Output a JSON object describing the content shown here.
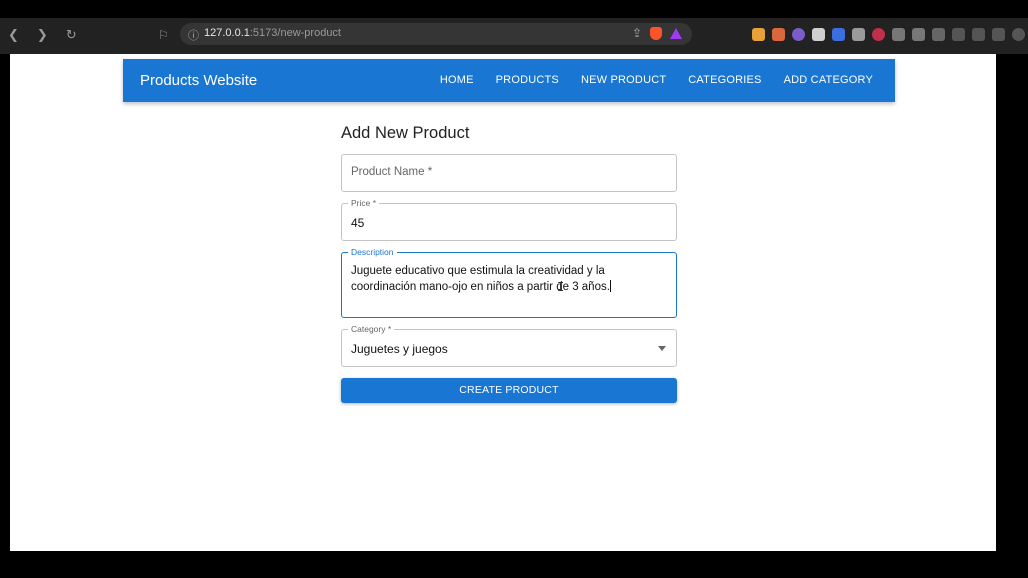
{
  "browser": {
    "url_host": "127.0.0.1",
    "url_path": ":5173/new-product"
  },
  "header": {
    "brand": "Products Website",
    "nav": [
      "HOME",
      "PRODUCTS",
      "NEW PRODUCT",
      "CATEGORIES",
      "ADD CATEGORY"
    ]
  },
  "form": {
    "title": "Add New Product",
    "product_name": {
      "placeholder": "Product Name *",
      "value": ""
    },
    "price": {
      "label": "Price *",
      "value": "45"
    },
    "description": {
      "label": "Description",
      "value": "Juguete educativo que estimula la creatividad y la coordinación mano-ojo en niños a partir de 3 años."
    },
    "category": {
      "label": "Category *",
      "value": "Juguetes y juegos"
    },
    "submit_label": "CREATE PRODUCT"
  },
  "colors": {
    "primary": "#1976d2",
    "chrome_bg": "#222222"
  }
}
